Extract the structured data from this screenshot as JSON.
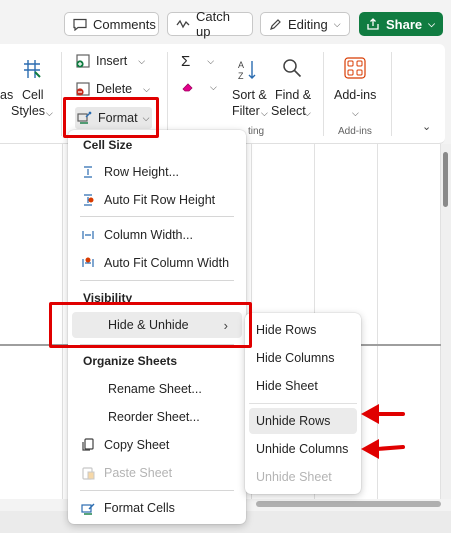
{
  "topbar": {
    "comments_label": "Comments",
    "catchup_label": "Catch up",
    "editing_label": "Editing",
    "share_label": "Share"
  },
  "ribbon": {
    "partial_label": "as",
    "cell_styles_line1": "Cell",
    "cell_styles_line2": "Styles",
    "insert_label": "Insert",
    "delete_label": "Delete",
    "format_label": "Format",
    "sort_filter_line1": "Sort &",
    "sort_filter_line2": "Filter",
    "find_select_line1": "Find &",
    "find_select_line2": "Select",
    "addins_label": "Add-ins",
    "addins_group_label": "Add-ins",
    "editing_group_partial": "ting"
  },
  "format_menu": {
    "cell_size_heading": "Cell Size",
    "row_height": "Row Height...",
    "autofit_row_height": "Auto Fit Row Height",
    "column_width": "Column Width...",
    "autofit_column_width": "Auto Fit Column Width",
    "visibility_heading": "Visibility",
    "hide_unhide": "Hide & Unhide",
    "organize_heading": "Organize Sheets",
    "rename_sheet": "Rename Sheet...",
    "reorder_sheet": "Reorder Sheet...",
    "copy_sheet": "Copy Sheet",
    "paste_sheet": "Paste Sheet",
    "format_cells": "Format Cells"
  },
  "hide_unhide_submenu": {
    "hide_rows": "Hide Rows",
    "hide_columns": "Hide Columns",
    "hide_sheet": "Hide Sheet",
    "unhide_rows": "Unhide Rows",
    "unhide_columns": "Unhide Columns",
    "unhide_sheet": "Unhide Sheet"
  },
  "colors": {
    "share_green": "#107c41",
    "annotation_red": "#e00000"
  }
}
